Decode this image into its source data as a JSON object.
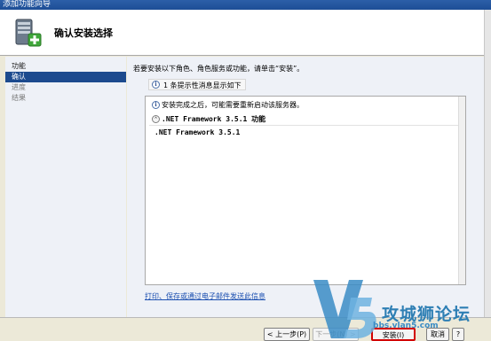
{
  "window": {
    "title": "添加功能向导"
  },
  "header": {
    "title": "确认安装选择",
    "icon": "server-add-icon"
  },
  "sidebar": {
    "items": [
      {
        "label": "功能",
        "state": "normal"
      },
      {
        "label": "确认",
        "state": "active"
      },
      {
        "label": "进度",
        "state": "muted"
      },
      {
        "label": "结果",
        "state": "muted"
      }
    ]
  },
  "main": {
    "intro": "若要安装以下角色、角色服务或功能，请单击“安装”。",
    "info_count": "1 条提示性消息显示如下",
    "panel": {
      "notice": "安装完成之后，可能需要重新启动该服务器。",
      "section_title": ".NET Framework 3.5.1 功能",
      "feature": ".NET Framework 3.5.1"
    },
    "link": "打印、保存或通过电子邮件发送此信息"
  },
  "buttons": {
    "prev": "< 上一步(P)",
    "next": "下一步(N) >",
    "install": "安装(I)",
    "cancel": "取消"
  },
  "watermark": {
    "text": "攻城狮论坛",
    "url": "bbs.vlan5.com"
  },
  "colors": {
    "accent": "#1c4a8e",
    "highlight": "#d20000",
    "watermark": "#2e7fb4"
  }
}
